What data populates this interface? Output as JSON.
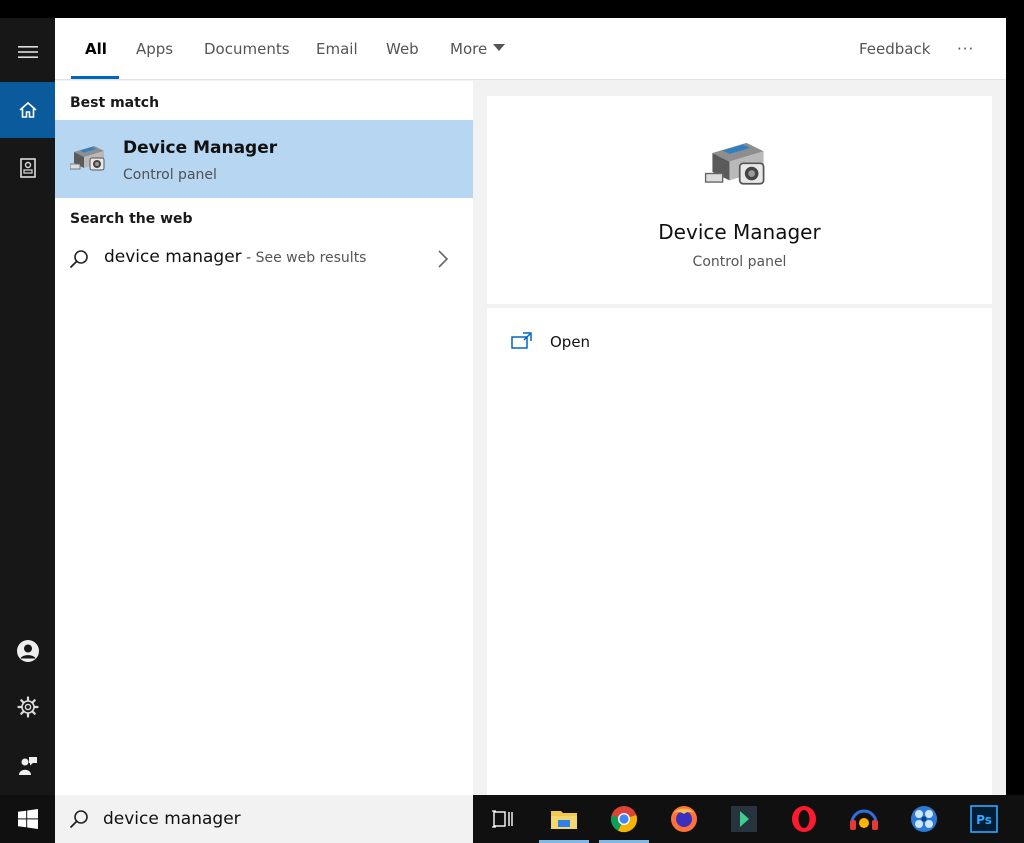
{
  "tabs": [
    {
      "label": "All",
      "active": true
    },
    {
      "label": "Apps"
    },
    {
      "label": "Documents"
    },
    {
      "label": "Email"
    },
    {
      "label": "Web"
    },
    {
      "label": "More"
    }
  ],
  "header": {
    "feedback_label": "Feedback",
    "more_options_label": "···"
  },
  "results": {
    "best_match_heading": "Best match",
    "best_match": {
      "title": "Device Manager",
      "subtitle": "Control panel",
      "icon": "device-manager-icon"
    },
    "web_heading": "Search the web",
    "web_result": {
      "query": "device manager",
      "suffix": " - See web results"
    }
  },
  "preview": {
    "title": "Device Manager",
    "subtitle": "Control panel",
    "actions": [
      {
        "label": "Open",
        "icon": "open-window-icon"
      }
    ]
  },
  "search": {
    "value": "device manager"
  },
  "rail": {
    "items": [
      "menu-icon",
      "home-icon",
      "notebook-icon",
      "account-icon",
      "settings-icon",
      "feedback-person-icon"
    ]
  },
  "taskbar": {
    "apps": [
      "task-view-icon",
      "file-explorer-icon",
      "chrome-icon",
      "firefox-icon",
      "editor-icon",
      "opera-icon",
      "headset-icon",
      "media-player-icon",
      "photoshop-icon"
    ],
    "photoshop_label": "Ps"
  },
  "colors": {
    "accent": "#0067c0",
    "selected": "#b6d6f2",
    "rail": "#171717",
    "taskbar": "#101010"
  }
}
